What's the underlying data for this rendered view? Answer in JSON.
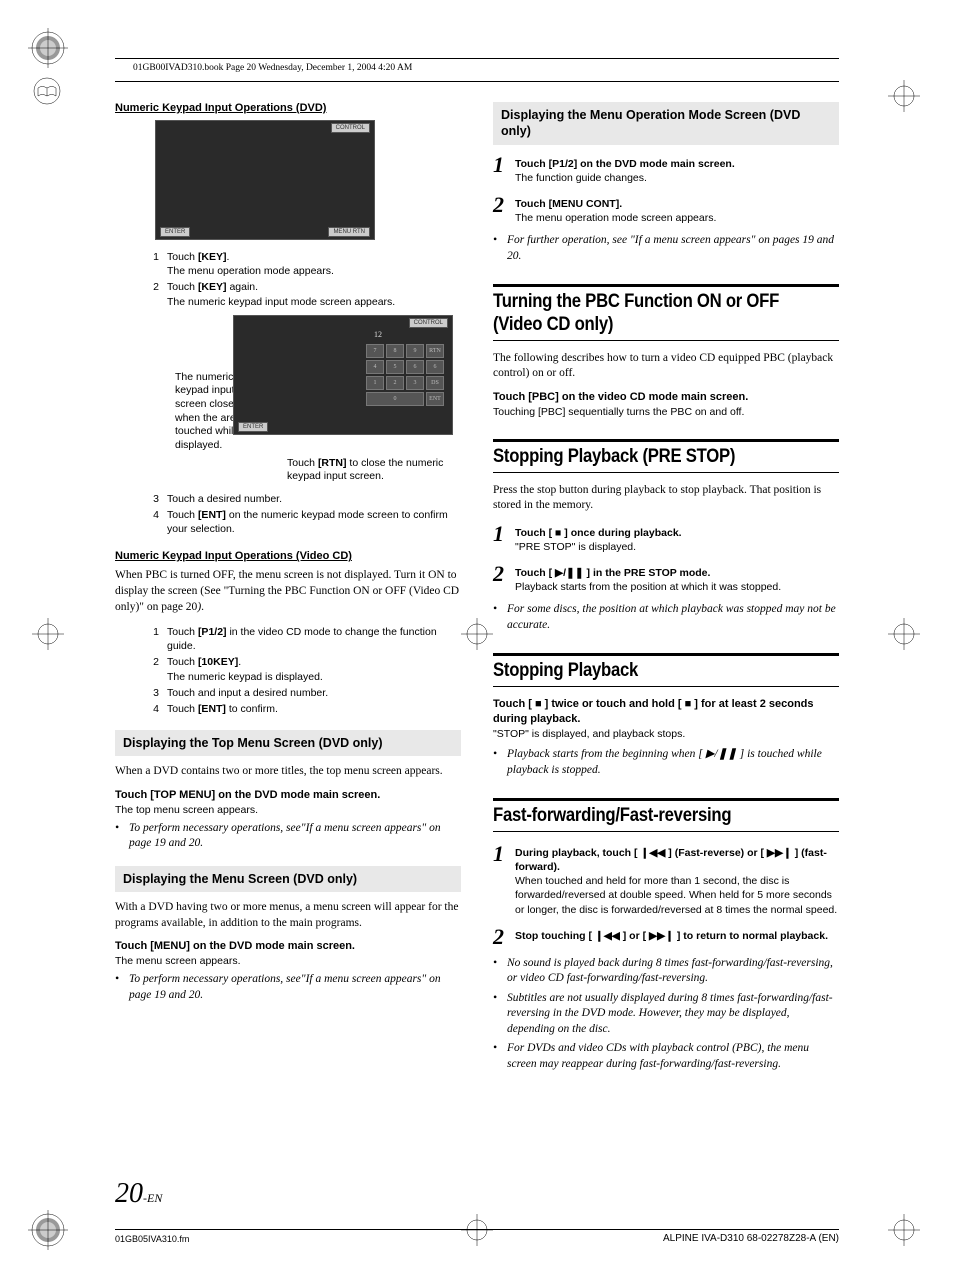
{
  "header": {
    "book_info": "01GB00IVAD310.book  Page 20  Wednesday, December 1, 2004  4:20 AM"
  },
  "left": {
    "heading1": "Numeric Keypad Input Operations (DVD)",
    "shot1": {
      "bottom_left": "ENTER",
      "bottom_right": "MENU RTN",
      "top_right": "CONTROL"
    },
    "steps1": [
      {
        "n": "1",
        "b": "Touch <b>[KEY]</b>.",
        "sub": "The menu operation mode appears."
      },
      {
        "n": "2",
        "b": "Touch <b>[KEY]</b> again.",
        "sub": "The numeric keypad input mode screen appears."
      }
    ],
    "callout_left": "The numeric keypad input screen closes when the area is touched while displayed.",
    "shot2": {
      "bottom_left": "ENTER",
      "top_right": "CONTROL",
      "num": "12",
      "keys": [
        "7",
        "8",
        "9",
        "RTN",
        "4",
        "5",
        "6",
        "6",
        "1",
        "2",
        "3",
        "DS",
        "",
        "0",
        "",
        "ENT"
      ]
    },
    "callout_btm": "Touch <b>[RTN]</b> to close the numeric keypad input screen.",
    "steps2": [
      {
        "n": "3",
        "b": "Touch a desired number."
      },
      {
        "n": "4",
        "b": "Touch <b>[ENT]</b> on the numeric keypad mode screen to confirm your selection."
      }
    ],
    "heading2": "Numeric Keypad Input Operations (Video CD)",
    "body2": "When PBC is turned OFF, the menu screen is not displayed. Turn it ON to display the screen (See \"Turning the PBC Function ON or OFF (Video CD only)\" on page 20<i>)</i>.",
    "steps3": [
      {
        "n": "1",
        "b": "Touch <b>[P1/2]</b> in the video CD mode to change the function guide."
      },
      {
        "n": "2",
        "b": "Touch <b>[10KEY]</b>.",
        "sub": "The numeric keypad is displayed."
      },
      {
        "n": "3",
        "b": "Touch and input a desired number."
      },
      {
        "n": "4",
        "b": "Touch <b>[ENT]</b> to confirm."
      }
    ],
    "gray1": "Displaying the Top Menu Screen (DVD only)",
    "body3": "When a DVD contains two or more titles, the top menu screen appears.",
    "instr1": "Touch <b>[TOP MENU]</b> on the DVD mode main screen.",
    "instr1_sub": "The top menu screen appears.",
    "note1": "To perform necessary operations, see\"If a menu screen appears\" on page 19 and 20.",
    "gray2": "Displaying the Menu Screen (DVD only)",
    "body4": "With a DVD having two or more menus, a menu screen will appear for the programs available, in addition to the main programs.",
    "instr2": "Touch <b>[MENU]</b> on the DVD mode main screen.",
    "instr2_sub": "The menu screen appears.",
    "note2": "To perform necessary operations, see\"If a menu screen appears\" on page 19 and 20."
  },
  "right": {
    "gray1": "Displaying the Menu Operation Mode Screen (DVD only)",
    "steps1": [
      {
        "n": "1",
        "b": "<b>Touch [P1/2] on the DVD mode main screen.</b>",
        "sub": "The function guide changes."
      },
      {
        "n": "2",
        "b": "<b>Touch [MENU CONT].</b>",
        "sub": "The menu operation mode screen appears."
      }
    ],
    "note1": "For further operation, see \"If a menu screen appears\" on  pages 19 and 20.",
    "sec1_title": "Turning the PBC Function ON or OFF (Video CD only)",
    "sec1_body": "The following describes how to turn a video CD equipped PBC (playback control) on or off.",
    "sec1_instr": "Touch <b>[PBC]</b> on the video CD mode main screen.",
    "sec1_sub": "Touching [PBC] sequentially turns the PBC on and off.",
    "sec2_title": "Stopping Playback (PRE STOP)",
    "sec2_body": "Press the stop button during playback to stop playback.  That position is stored in the memory.",
    "sec2_steps": [
      {
        "n": "1",
        "b": "<b>Touch [ ■ ] once during playback.</b>",
        "sub": "\"PRE STOP\" is displayed."
      },
      {
        "n": "2",
        "b": "<b>Touch [ ▶/❚❚ ] in the PRE STOP mode.</b>",
        "sub": "Playback starts from the position at which it was stopped."
      }
    ],
    "sec2_note": "For some discs, the position at which playback was stopped may not be accurate.",
    "sec3_title": "Stopping Playback",
    "sec3_instr": "Touch [ ■ ] twice or touch and hold [ ■ ] for at least 2 seconds during playback.",
    "sec3_sub": "\"STOP\" is displayed, and playback stops.",
    "sec3_note": "Playback starts from the beginning when [ ▶/❚❚ ] is touched while playback is stopped.",
    "sec4_title": "Fast-forwarding/Fast-reversing",
    "sec4_steps": [
      {
        "n": "1",
        "b": "<b>During playback, touch [ ❙◀◀ ] (Fast-reverse) or [ ▶▶❙ ] (fast-forward).</b>",
        "sub": "When touched and held for more than 1 second, the disc is forwarded/reversed at double speed. When held for 5 more seconds or longer, the disc is forwarded/reversed at 8 times the normal speed."
      },
      {
        "n": "2",
        "b": "<b>Stop touching [ ❙◀◀ ] or [ ▶▶❙ ] to return to normal playback.</b>"
      }
    ],
    "sec4_notes": [
      "No sound is played back during 8 times fast-forwarding/fast-reversing, or video CD fast-forwarding/fast-reversing.",
      "Subtitles are not usually displayed during 8 times fast-forwarding/fast-reversing in the DVD mode. However, they may be displayed, depending on the disc.",
      "For DVDs and video CDs with playback control (PBC), the menu screen may reappear during fast-forwarding/fast-reversing."
    ]
  },
  "footer": {
    "page": "20",
    "suffix": "-EN",
    "left": "01GB05IVA310.fm",
    "right": "ALPINE IVA-D310 68-02278Z28-A (EN)"
  }
}
